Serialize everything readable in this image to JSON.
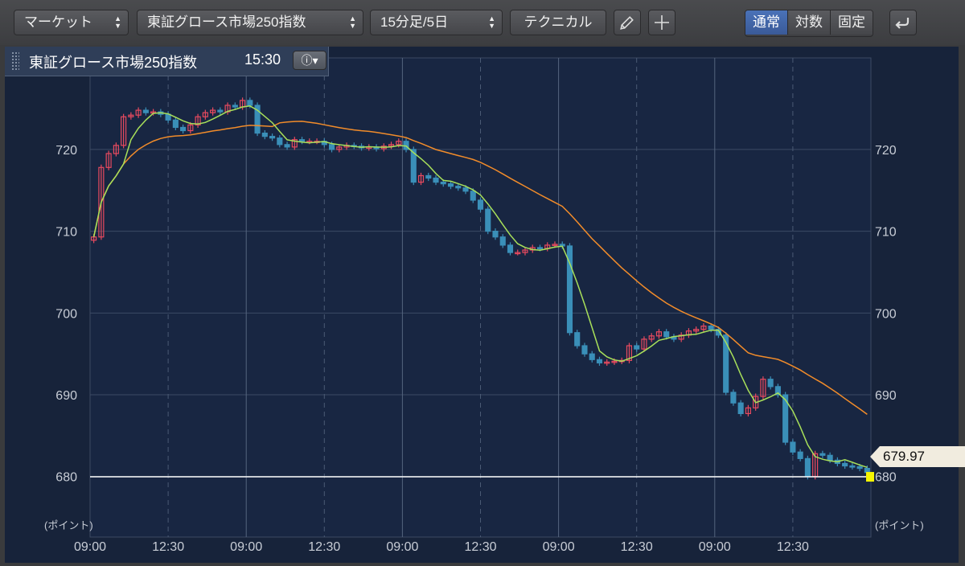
{
  "toolbar": {
    "market_label": "マーケット",
    "index_select": "東証グロース市場250指数",
    "interval_select": "15分足/5日",
    "technical_label": "テクニカル",
    "scale_modes": [
      "通常",
      "対数",
      "固定"
    ],
    "active_scale": "通常"
  },
  "title_box": {
    "name": "東証グロース市場250指数",
    "time": "15:30"
  },
  "chart_data": {
    "type": "candlestick",
    "unit_label": "(ポイント)",
    "y_ticks": [
      680,
      690,
      700,
      710,
      720
    ],
    "ylim": [
      672.6,
      731.2
    ],
    "x_tick_labels": [
      "09:00",
      "12:30",
      "09:00",
      "12:30",
      "09:00",
      "12:30",
      "09:00",
      "12:30",
      "09:00",
      "12:30"
    ],
    "last_price": "679.97",
    "last_value": 679.97,
    "colors": {
      "up": "#e84a5f",
      "down": "#3a8fb8",
      "fast_ma": "#a8e05a",
      "slow_ma": "#f28c2a"
    },
    "series": [
      {
        "values": [
          709.3,
          717.8,
          719.5,
          720.5,
          724.0,
          724.2,
          724.8,
          724.5,
          724.6,
          724.3,
          723.6,
          722.7,
          722.3,
          723.0,
          724.0,
          724.5,
          724.8,
          724.6,
          725.4,
          725.2,
          726.0
        ]
      },
      {
        "values": [
          725.4,
          722.0,
          721.6,
          721.4,
          720.6,
          720.3,
          721.2,
          721.0,
          721.0,
          721.0,
          720.6,
          720.0,
          720.3,
          720.5,
          720.4,
          720.2,
          720.3,
          720.1,
          720.4,
          720.6,
          721.0
        ]
      },
      {
        "values": [
          720.0,
          716.0,
          716.8,
          716.5,
          716.0,
          715.8,
          715.5,
          715.3,
          714.9,
          713.8,
          712.7,
          710.0,
          709.3,
          708.3,
          707.4,
          707.4,
          707.7,
          708.0,
          707.9,
          708.3,
          708.4
        ]
      },
      {
        "values": [
          708.2,
          697.6,
          696.0,
          695.0,
          694.3,
          693.9,
          694.0,
          694.1,
          694.2,
          696.0,
          695.6,
          696.8,
          697.2,
          697.7,
          697.1,
          696.8,
          697.3,
          697.8,
          698.0,
          698.4,
          698.0
        ]
      },
      {
        "values": [
          697.3,
          690.3,
          689.0,
          687.7,
          688.4,
          689.8,
          691.9,
          691.0,
          690.0,
          684.2,
          683.0,
          682.2,
          680.0,
          682.8,
          682.6,
          682.0,
          681.6,
          681.3,
          681.2,
          681.0,
          680.5
        ]
      }
    ]
  }
}
